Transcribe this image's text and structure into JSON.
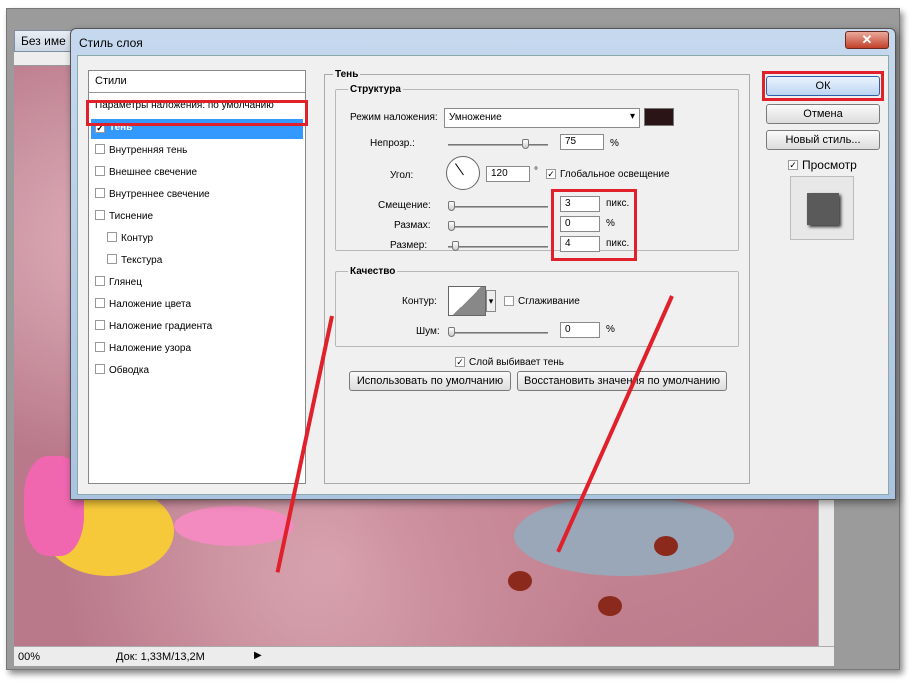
{
  "document": {
    "title": "Без име",
    "status": {
      "zoom": "00%",
      "doc_info": "Док: 1,33М/13,2М"
    }
  },
  "dialog": {
    "title": "Стиль слоя",
    "close_glyph": "✕",
    "styles_header": "Стили",
    "styles": [
      {
        "label": "Параметры наложения: по умолчанию",
        "checkbox": false,
        "checked": false
      },
      {
        "label": "Тень",
        "checkbox": true,
        "checked": true,
        "selected": true
      },
      {
        "label": "Внутренняя тень",
        "checkbox": true,
        "checked": false
      },
      {
        "label": "Внешнее свечение",
        "checkbox": true,
        "checked": false
      },
      {
        "label": "Внутреннее свечение",
        "checkbox": true,
        "checked": false
      },
      {
        "label": "Тиснение",
        "checkbox": true,
        "checked": false
      },
      {
        "label": "Контур",
        "checkbox": true,
        "checked": false,
        "indent": true
      },
      {
        "label": "Текстура",
        "checkbox": true,
        "checked": false,
        "indent": true
      },
      {
        "label": "Глянец",
        "checkbox": true,
        "checked": false
      },
      {
        "label": "Наложение цвета",
        "checkbox": true,
        "checked": false
      },
      {
        "label": "Наложение градиента",
        "checkbox": true,
        "checked": false
      },
      {
        "label": "Наложение узора",
        "checkbox": true,
        "checked": false
      },
      {
        "label": "Обводка",
        "checkbox": true,
        "checked": false
      }
    ],
    "panel": {
      "title": "Тень",
      "structure": {
        "title": "Структура",
        "blend_mode_label": "Режим наложения:",
        "blend_mode_value": "Умножение",
        "shadow_color": "#2a1416",
        "opacity_label": "Непрозр.:",
        "opacity_value": "75",
        "opacity_unit": "%",
        "angle_label": "Угол:",
        "angle_value": "120",
        "angle_unit": "°",
        "global_light_label": "Глобальное освещение",
        "global_light_checked": true,
        "distance_label": "Смещение:",
        "distance_value": "3",
        "distance_unit": "пикс.",
        "spread_label": "Размах:",
        "spread_value": "0",
        "spread_unit": "%",
        "size_label": "Размер:",
        "size_value": "4",
        "size_unit": "пикс."
      },
      "quality": {
        "title": "Качество",
        "contour_label": "Контур:",
        "antialias_label": "Сглаживание",
        "noise_label": "Шум:",
        "noise_value": "0",
        "noise_unit": "%"
      },
      "knockout_label": "Слой выбивает тень",
      "default_button": "Использовать по умолчанию",
      "reset_button": "Восстановить значения по умолчанию"
    },
    "buttons": {
      "ok": "ОК",
      "cancel": "Отмена",
      "new_style": "Новый стиль...",
      "preview_label": "Просмотр"
    },
    "checkmark": "✓",
    "dropdown_arrow": "▾"
  },
  "colors": {
    "highlight": "#e0202a",
    "selection": "#3399ff"
  }
}
